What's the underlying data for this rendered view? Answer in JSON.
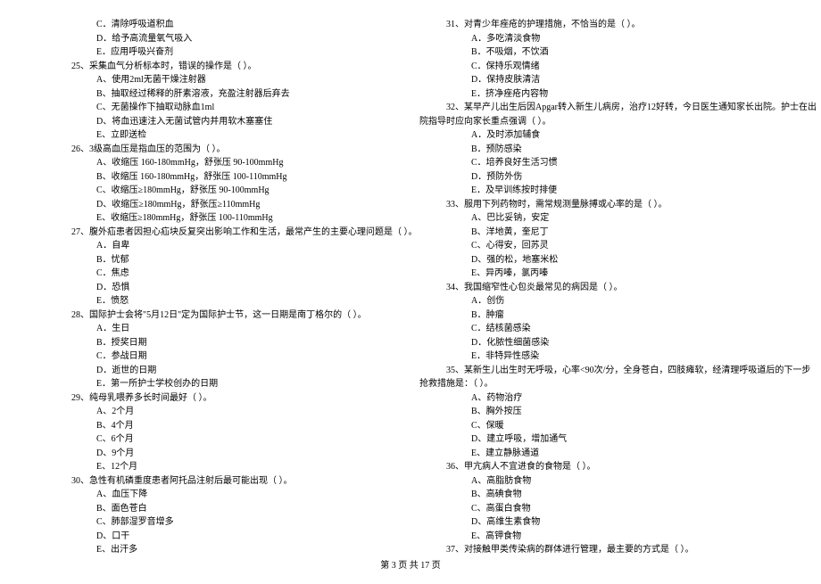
{
  "footer": "第 3 页  共 17 页",
  "left": {
    "pre_opts": [
      "C．清除呼吸道积血",
      "D．给予高流量氧气吸入",
      "E．应用呼吸兴奋剂"
    ],
    "questions": [
      {
        "stem": "25、采集血气分析标本时，错误的操作是（     ）。",
        "opts": [
          "A、使用2ml无菌干燥注射器",
          "B、抽取经过稀释的肝素溶液，充盈注射器后弃去",
          "C、无菌操作下抽取动脉血1ml",
          "D、将血迅速注入无菌试管内并用软木塞塞住",
          "E、立即送检"
        ]
      },
      {
        "stem": "26、3级高血压是指血压的范围为（     ）。",
        "opts": [
          "A、收缩压 160-180mmHg，舒张压 90-100mmHg",
          "B、收缩压 160-180mmHg，舒张压 100-110mmHg",
          "C、收缩压≥180mmHg，舒张压 90-100mmHg",
          "D、收缩压≥180mmHg，舒张压≥110mmHg",
          "E、收缩压≥180mmHg，舒张压 100-110mmHg"
        ]
      },
      {
        "stem": "27、腹外疝患者因担心疝块反复突出影响工作和生活，最常产生的主要心理问题是（     ）。",
        "opts": [
          "A．自卑",
          "B．忧郁",
          "C．焦虑",
          "D．恐惧",
          "E．愤怒"
        ]
      },
      {
        "stem": "28、国际护士会将\"5月12日\"定为国际护士节，这一日期是南丁格尔的（     ）。",
        "opts": [
          "A．生日",
          "B．授奖日期",
          "C．参战日期",
          "D．逝世的日期",
          "E．第一所护士学校创办的日期"
        ]
      },
      {
        "stem": "29、纯母乳喂养多长时间最好（     ）。",
        "opts": [
          "A、2个月",
          "B、4个月",
          "C、6个月",
          "D、9个月",
          "E、12个月"
        ]
      },
      {
        "stem": "30、急性有机磷重度患者阿托品注射后最可能出现（     ）。",
        "opts": [
          "A、血压下降",
          "B、面色苍白",
          "C、肺部湿罗音增多",
          "D、口干",
          "E、出汗多"
        ]
      }
    ]
  },
  "right": {
    "questions": [
      {
        "stem": "31、对青少年痤疮的护理措施，不恰当的是（     ）。",
        "opts": [
          "A．多吃清淡食物",
          "B．不吸烟，不饮酒",
          "C．保持乐观情绪",
          "D．保持皮肤清洁",
          "E．挤净痤疮内容物"
        ]
      },
      {
        "stem_lines": [
          "32、某早产儿出生后因Apgar转入新生儿病房，治疗12好转，今日医生通知家长出院。护士在出",
          "院指导时应向家长重点强调（     ）。"
        ],
        "opts": [
          "A．及时添加辅食",
          "B．预防感染",
          "C．培养良好生活习惯",
          "D．预防外伤",
          "E．及早训练按时排便"
        ]
      },
      {
        "stem": "33、服用下列药物时，需常规测量脉搏或心率的是（     ）。",
        "opts": [
          "A、巴比妥钠，安定",
          "B、洋地黄，奎尼丁",
          "C、心得安，回苏灵",
          "D、强的松，地塞米松",
          "E、异丙嗪，氯丙嗪"
        ]
      },
      {
        "stem": "34、我国缩窄性心包炎最常见的病因是（     ）。",
        "opts": [
          "A．创伤",
          "B．肿瘤",
          "C．结核菌感染",
          "D．化脓性细菌感染",
          "E．非特异性感染"
        ]
      },
      {
        "stem_lines": [
          "35、某新生儿出生时无呼吸，心率<90次/分，全身苍白，四肢瘫软，经清理呼吸道后的下一步",
          "抢救措施是：（    ）。"
        ],
        "opts": [
          "A、药物治疗",
          "B、胸外按压",
          "C、保暖",
          "D、建立呼吸，增加通气",
          "E、建立静脉通道"
        ]
      },
      {
        "stem": "36、甲亢病人不宜进食的食物是（     ）。",
        "opts": [
          "A、高脂肪食物",
          "B、高碘食物",
          "C、高蛋白食物",
          "D、高维生素食物",
          "E、高钾食物"
        ]
      },
      {
        "stem": "37、对接触甲类传染病的群体进行管理，最主要的方式是（     ）。",
        "opts": []
      }
    ]
  }
}
